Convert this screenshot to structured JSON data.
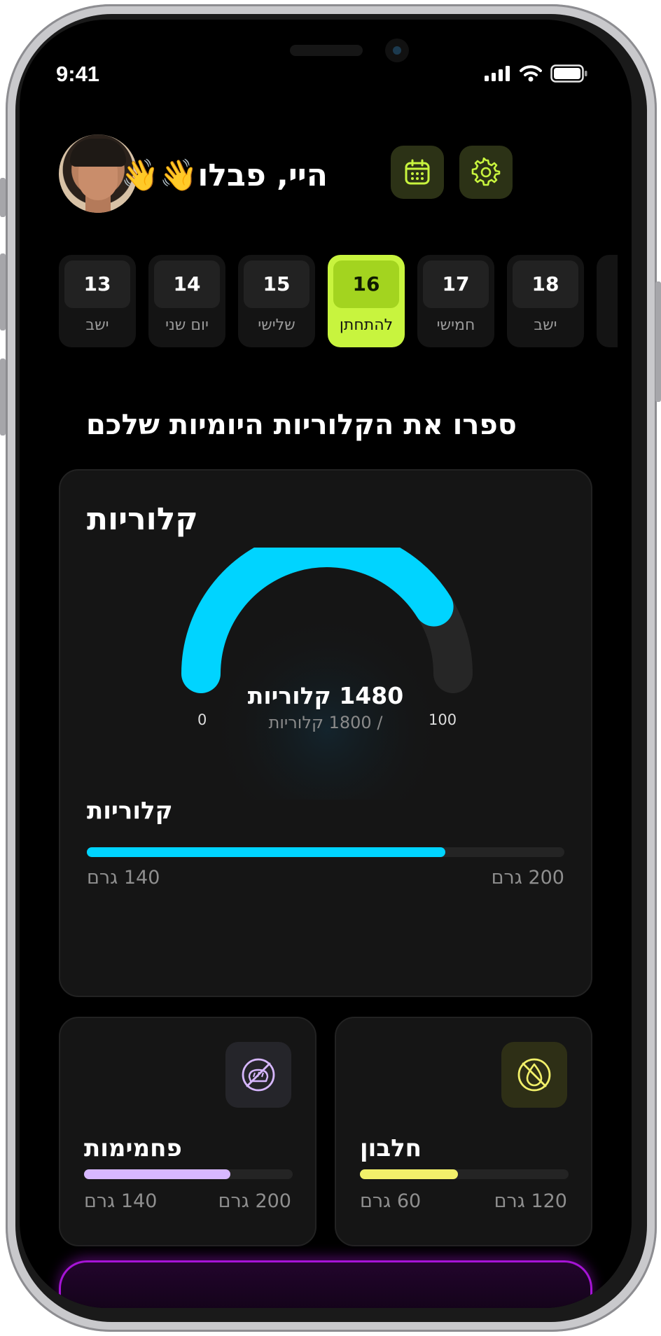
{
  "status_bar": {
    "time": "9:41"
  },
  "header": {
    "greeting": "היי, פבלו👋👋",
    "calendar_icon": "calendar-icon",
    "settings_icon": "gear-icon",
    "accent_color": "#c8f43e"
  },
  "days": [
    {
      "num": "13",
      "label": "ישב",
      "active": false
    },
    {
      "num": "14",
      "label": "יום שני",
      "active": false
    },
    {
      "num": "15",
      "label": "שלישי",
      "active": false
    },
    {
      "num": "16",
      "label": "להתחתן",
      "active": true
    },
    {
      "num": "17",
      "label": "חמישי",
      "active": false
    },
    {
      "num": "18",
      "label": "ישב",
      "active": false
    }
  ],
  "section_title": "ספרו את הקלוריות היומיות שלכם",
  "calories_card": {
    "title": "קלוריות",
    "gauge": {
      "value_text": "1480 קלוריות",
      "sub_text": "/ 1800 קלוריות",
      "value": 1480,
      "max": 1800,
      "min_label": "0",
      "max_label": "100",
      "color": "#00d4ff"
    },
    "bar": {
      "label": "קלוריות",
      "left_amount": "140 גרם",
      "right_amount": "200 גרם",
      "fraction": 0.75,
      "color": "#00d4ff"
    }
  },
  "carbs_card": {
    "title": "פחמימות",
    "icon": "no-bread-icon",
    "left_amount": "140 גרם",
    "right_amount": "200 גרם",
    "fraction": 0.7,
    "color": "#d7b7ff"
  },
  "protein_card": {
    "title": "חלבון",
    "icon": "no-drop-icon",
    "left_amount": "60 גרם",
    "right_amount": "120 גרם",
    "fraction": 0.47,
    "color": "#f2f06a"
  }
}
